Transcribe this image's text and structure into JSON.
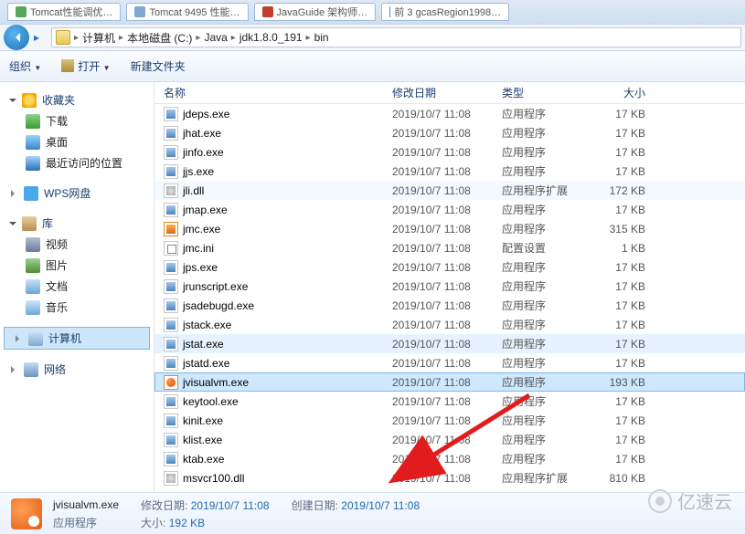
{
  "tabs": [
    {
      "fav": "#56a75b",
      "label": "Tomcat性能调优…"
    },
    {
      "fav": "#7fa9d2",
      "label": "Tomcat 9495 性能…"
    },
    {
      "fav": "#c33d2e",
      "label": "JavaGuide 架构师…"
    },
    {
      "fav": "#4a89d2",
      "label": "前 3 gcasRegion1998…"
    }
  ],
  "breadcrumb": [
    "计算机",
    "本地磁盘 (C:)",
    "Java",
    "jdk1.8.0_191",
    "bin"
  ],
  "toolbar": {
    "org": "组织",
    "open": "打开",
    "new": "新建文件夹"
  },
  "sidebar": {
    "fav": {
      "hdr": "收藏夹",
      "items": [
        "下载",
        "桌面",
        "最近访问的位置"
      ]
    },
    "wps": "WPS网盘",
    "lib": {
      "hdr": "库",
      "items": [
        "视频",
        "图片",
        "文档",
        "音乐"
      ]
    },
    "comp": "计算机",
    "net": "网络"
  },
  "columns": {
    "name": "名称",
    "date": "修改日期",
    "type": "类型",
    "size": "大小"
  },
  "files": [
    {
      "n": "jdeps.exe",
      "ic": "exe",
      "d": "2019/10/7 11:08",
      "t": "应用程序",
      "s": "17 KB"
    },
    {
      "n": "jhat.exe",
      "ic": "exe",
      "d": "2019/10/7 11:08",
      "t": "应用程序",
      "s": "17 KB"
    },
    {
      "n": "jinfo.exe",
      "ic": "exe",
      "d": "2019/10/7 11:08",
      "t": "应用程序",
      "s": "17 KB"
    },
    {
      "n": "jjs.exe",
      "ic": "exe",
      "d": "2019/10/7 11:08",
      "t": "应用程序",
      "s": "17 KB"
    },
    {
      "n": "jli.dll",
      "ic": "dll",
      "d": "2019/10/7 11:08",
      "t": "应用程序扩展",
      "s": "172 KB",
      "pale": true
    },
    {
      "n": "jmap.exe",
      "ic": "exe",
      "d": "2019/10/7 11:08",
      "t": "应用程序",
      "s": "17 KB"
    },
    {
      "n": "jmc.exe",
      "ic": "jmc",
      "d": "2019/10/7 11:08",
      "t": "应用程序",
      "s": "315 KB"
    },
    {
      "n": "jmc.ini",
      "ic": "ini",
      "d": "2019/10/7 11:08",
      "t": "配置设置",
      "s": "1 KB"
    },
    {
      "n": "jps.exe",
      "ic": "exe",
      "d": "2019/10/7 11:08",
      "t": "应用程序",
      "s": "17 KB"
    },
    {
      "n": "jrunscript.exe",
      "ic": "exe",
      "d": "2019/10/7 11:08",
      "t": "应用程序",
      "s": "17 KB"
    },
    {
      "n": "jsadebugd.exe",
      "ic": "exe",
      "d": "2019/10/7 11:08",
      "t": "应用程序",
      "s": "17 KB"
    },
    {
      "n": "jstack.exe",
      "ic": "exe",
      "d": "2019/10/7 11:08",
      "t": "应用程序",
      "s": "17 KB"
    },
    {
      "n": "jstat.exe",
      "ic": "exe",
      "d": "2019/10/7 11:08",
      "t": "应用程序",
      "s": "17 KB",
      "hi2": true
    },
    {
      "n": "jstatd.exe",
      "ic": "exe",
      "d": "2019/10/7 11:08",
      "t": "应用程序",
      "s": "17 KB"
    },
    {
      "n": "jvisualvm.exe",
      "ic": "jvm",
      "d": "2019/10/7 11:08",
      "t": "应用程序",
      "s": "193 KB",
      "sel": true
    },
    {
      "n": "keytool.exe",
      "ic": "exe",
      "d": "2019/10/7 11:08",
      "t": "应用程序",
      "s": "17 KB"
    },
    {
      "n": "kinit.exe",
      "ic": "exe",
      "d": "2019/10/7 11:08",
      "t": "应用程序",
      "s": "17 KB"
    },
    {
      "n": "klist.exe",
      "ic": "exe",
      "d": "2019/10/7 11:08",
      "t": "应用程序",
      "s": "17 KB"
    },
    {
      "n": "ktab.exe",
      "ic": "exe",
      "d": "2019/10/7 11:08",
      "t": "应用程序",
      "s": "17 KB"
    },
    {
      "n": "msvcr100.dll",
      "ic": "dll",
      "d": "2019/10/7 11:08",
      "t": "应用程序扩展",
      "s": "810 KB"
    }
  ],
  "details": {
    "name": "jvisualvm.exe",
    "type": "应用程序",
    "mod_lbl": "修改日期:",
    "mod": "2019/10/7 11:08",
    "size_lbl": "大小:",
    "size": "192 KB",
    "created_lbl": "创建日期:",
    "created": "2019/10/7 11:08"
  },
  "watermark": "亿速云"
}
